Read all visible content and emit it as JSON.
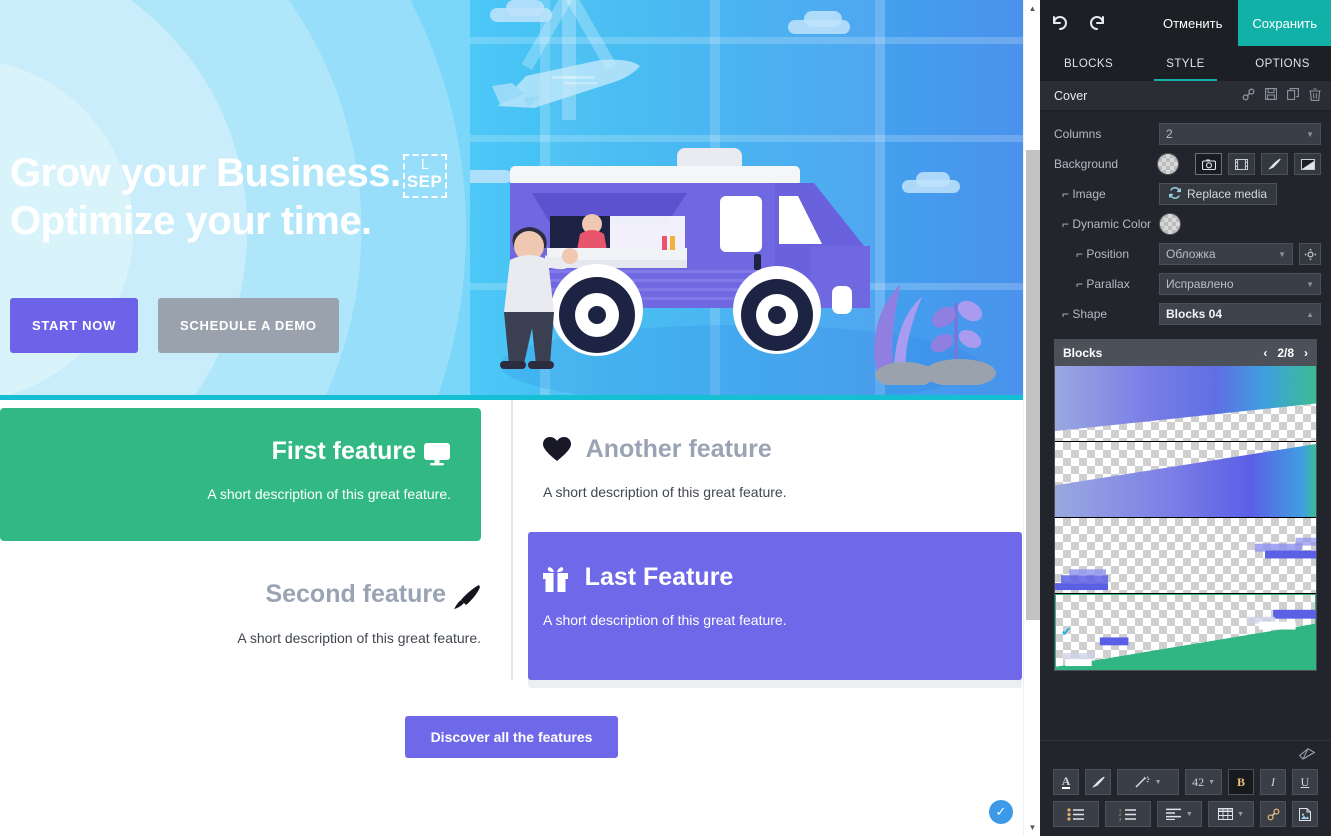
{
  "canvas": {
    "hero": {
      "heading_line1": "Grow your Business.",
      "heading_line2": "Optimize your time.",
      "separator_marker": {
        "corner_label": "L",
        "label": "SEP"
      },
      "primary_button": "START NOW",
      "secondary_button": "SCHEDULE A DEMO"
    },
    "features": [
      {
        "title": "First feature",
        "icon": "desktop-monitor-icon",
        "glyph": "⬛",
        "description": "A short description of this great feature."
      },
      {
        "title": "Another feature",
        "icon": "heart-icon",
        "glyph": "♥",
        "description": "A short description of this great feature."
      },
      {
        "title": "Second feature",
        "icon": "paint-brush-icon",
        "glyph": "🖌",
        "description": "A short description of this great feature."
      },
      {
        "title": "Last Feature",
        "icon": "gift-icon",
        "glyph": "🎁",
        "description": "A short description of this great feature."
      }
    ],
    "discover_button": "Discover all the features",
    "status_badge": {
      "name": "saved-check-badge",
      "glyph": "✓"
    },
    "colors": {
      "green_card": "#32b983",
      "purple_card": "#6f68e8",
      "primary_button": "#6c63e8",
      "muted_button": "#9aa3ad",
      "selection_outline": "#14bfd4"
    }
  },
  "panel": {
    "topbar": {
      "undo_icon": "undo-arrow-icon",
      "undo_glyph": "↺",
      "redo_icon": "redo-arrow-icon",
      "redo_glyph": "↻",
      "cancel_label": "Отменить",
      "save_label": "Сохранить",
      "save_color": "#11b1a8"
    },
    "tabs": [
      {
        "label": "BLOCKS",
        "active": false
      },
      {
        "label": "STYLE",
        "active": true
      },
      {
        "label": "OPTIONS",
        "active": false
      }
    ],
    "section": {
      "title": "Cover",
      "actions": [
        {
          "name": "link-icon",
          "glyph": "⚗"
        },
        {
          "name": "save-disk-icon",
          "glyph": "Ὃe"
        },
        {
          "name": "duplicate-icon",
          "glyph": "⧉"
        },
        {
          "name": "trash-icon",
          "glyph": "🗑"
        }
      ]
    },
    "rows": {
      "columns": {
        "label": "Columns",
        "value": "2"
      },
      "background": {
        "label": "Background",
        "swatch": "transparent-checker",
        "buttons": [
          {
            "name": "image-camera-icon",
            "glyph": "▣",
            "selected": true
          },
          {
            "name": "video-film-icon",
            "glyph": "▓",
            "selected": false
          },
          {
            "name": "paint-brush-icon",
            "glyph": "╱",
            "selected": false
          },
          {
            "name": "gradient-icon",
            "glyph": "◢",
            "selected": false
          }
        ]
      },
      "image": {
        "label": "⌐ Image",
        "button": "Replace media",
        "button_icon": "refresh-icon",
        "button_glyph": "⟳"
      },
      "dynamic_color": {
        "label": "⌐ Dynamic Color",
        "swatch": "transparent-checker"
      },
      "position": {
        "label": "⌐ Position",
        "value": "Обложка",
        "focus_icon": "reposition-icon",
        "focus_glyph": "✥"
      },
      "parallax": {
        "label": "⌐ Parallax",
        "value": "Исправлено"
      },
      "shape": {
        "label": "⌐ Shape",
        "value": "Blocks 04"
      }
    },
    "shape_browser": {
      "title": "Blocks",
      "prev_glyph": "‹",
      "next_glyph": "›",
      "page": "2/8",
      "items": [
        {
          "name": "shape-preview-1",
          "selected": false
        },
        {
          "name": "shape-preview-2",
          "selected": false
        },
        {
          "name": "shape-preview-3",
          "selected": false
        },
        {
          "name": "shape-preview-4",
          "selected": true,
          "check_glyph": "✔"
        }
      ]
    },
    "text_toolbar": {
      "eraser": {
        "name": "clear-format-icon",
        "glyph": "▱"
      },
      "row1": [
        {
          "name": "font-color-button",
          "label": "A"
        },
        {
          "name": "highlight-color-button",
          "label": "╱"
        },
        {
          "name": "text-effect-select",
          "label": "✧"
        },
        {
          "name": "font-size-select",
          "label": "42"
        },
        {
          "name": "bold-button",
          "label": "B"
        },
        {
          "name": "italic-button",
          "label": "I"
        },
        {
          "name": "underline-button",
          "label": "U"
        }
      ],
      "row2": [
        {
          "name": "bulleted-list-button",
          "label": "☰"
        },
        {
          "name": "numbered-list-button",
          "label": "☰"
        },
        {
          "name": "align-select",
          "label": "☰"
        },
        {
          "name": "table-select",
          "label": "▦"
        },
        {
          "name": "insert-link-button",
          "label": "⚗"
        },
        {
          "name": "insert-image-button",
          "label": "Ὓc"
        }
      ]
    }
  }
}
